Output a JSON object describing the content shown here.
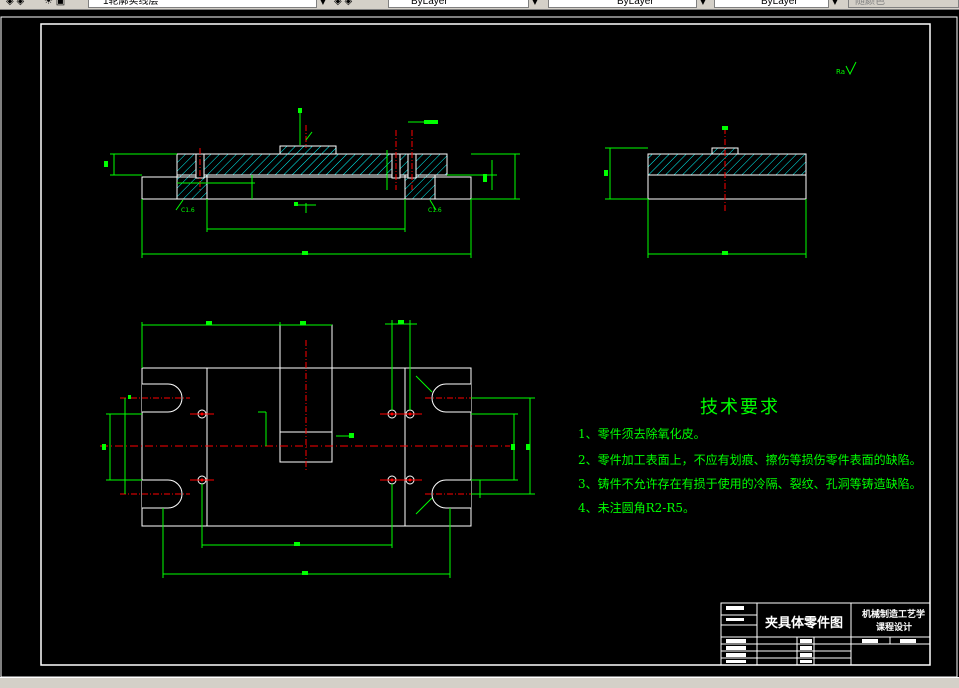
{
  "toolbar": {
    "layer_name": "1轮廓实线层",
    "color_value": "ByLayer",
    "linetype_value": "ByLayer",
    "lineweight_value": "ByLayer",
    "plotstyle_value": "随颜色"
  },
  "drawing": {
    "tech_requirements_title": "技术要求",
    "tech_requirements": [
      "1、零件须去除氧化皮。",
      "2、零件加工表面上，不应有划痕、擦伤等损伤零件表面的缺陷。",
      "3、铸件不允许存在有损于使用的冷隔、裂纹、孔洞等铸造缺陷。",
      "4、未注圆角R2-R5。"
    ],
    "title_block": {
      "part_name": "夹具体零件图",
      "course_line1": "机械制造工艺学",
      "course_line2": "课程设计"
    },
    "colors": {
      "background": "#000000",
      "outline": "#ffffff",
      "dimension": "#00ff00",
      "hatch": "#00ffff",
      "centerline": "#ff0000"
    }
  }
}
